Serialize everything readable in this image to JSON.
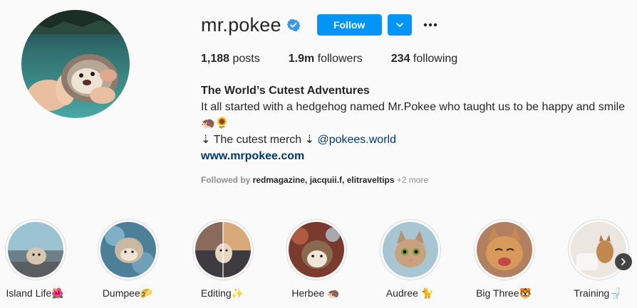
{
  "profile": {
    "username": "mr.pokee",
    "follow_label": "Follow",
    "stats": {
      "posts_count": "1,188",
      "posts_label": " posts",
      "followers_count": "1.9m",
      "followers_label": " followers",
      "following_count": "234",
      "following_label": " following"
    },
    "bio": {
      "name": "The World’s Cutest Adventures",
      "line1": "It all started with a hedgehog named Mr.Pokee who taught us to be happy and smile",
      "line2": "🦔🌻",
      "line3_prefix": "⇣ The cutest merch ⇣ ",
      "line3_link": "@pokees.world",
      "website": "www.mrpokee.com"
    },
    "followed_by": {
      "prefix": "Followed by ",
      "users": "redmagazine, jacquii.f, elitraveltips",
      "more": " +2 more"
    }
  },
  "highlights": [
    {
      "label": "Island Life🌺",
      "color": "#7fa9b8"
    },
    {
      "label": "Dumpee🌮",
      "color": "#5d8fa8"
    },
    {
      "label": "Editing✨",
      "color": "#b07a5a"
    },
    {
      "label": "Herbee 🦔",
      "color": "#a05a40"
    },
    {
      "label": "Audree 🐈",
      "color": "#9ab7c4"
    },
    {
      "label": "Big Three🐯",
      "color": "#c88c5a"
    },
    {
      "label": "Training🚽",
      "color": "#e8e0d8"
    }
  ],
  "colors": {
    "accent": "#0095f6",
    "link": "#00376b",
    "verified": "#3897f0"
  },
  "icons": {
    "verified": "verified-badge-icon",
    "chevron": "chevron-down-icon",
    "more": "more-options-icon",
    "next": "chevron-right-icon"
  }
}
